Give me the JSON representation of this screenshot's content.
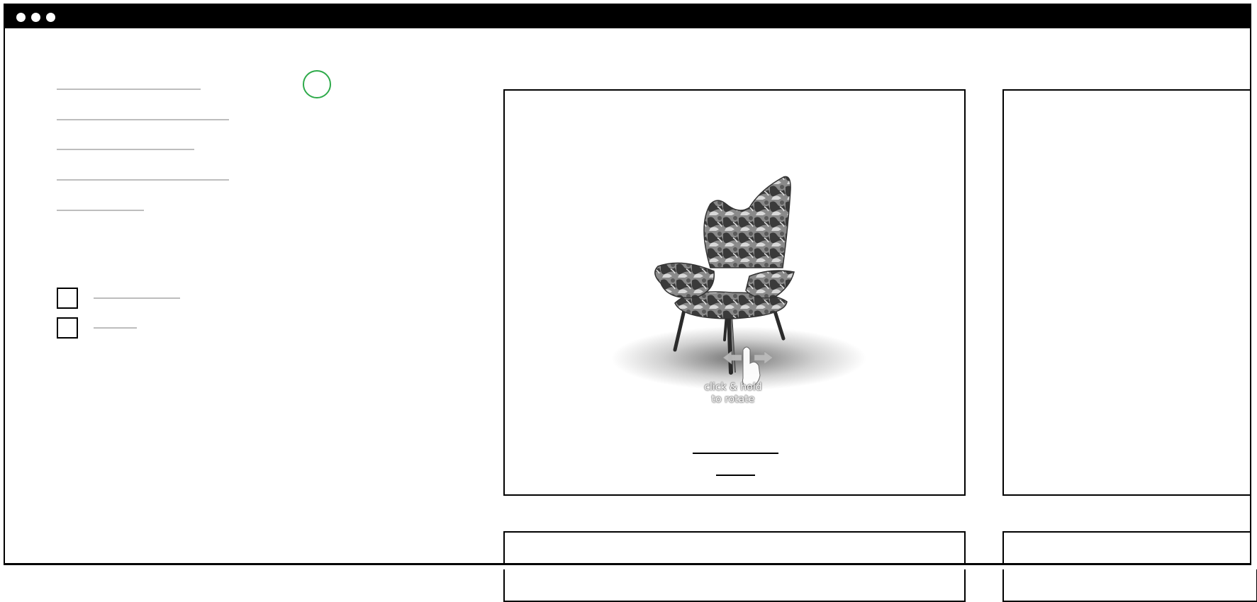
{
  "filters": {
    "nav_item_count": 5,
    "checkbox_options": [
      {
        "checked": false
      },
      {
        "checked": false
      }
    ]
  },
  "colors": {
    "accent_circle": "#2eaa4a",
    "placeholder_line": "#bdbdbd",
    "border": "#000000"
  },
  "product_card": {
    "image": "armchair-3d-viewer",
    "rotate_hint_line1": "click & hold",
    "rotate_hint_line2": "to rotate"
  },
  "icons": {
    "window_controls": [
      "window-dot-icon",
      "window-dot-icon",
      "window-dot-icon"
    ],
    "rotate": "hand-drag-rotate-icon"
  }
}
